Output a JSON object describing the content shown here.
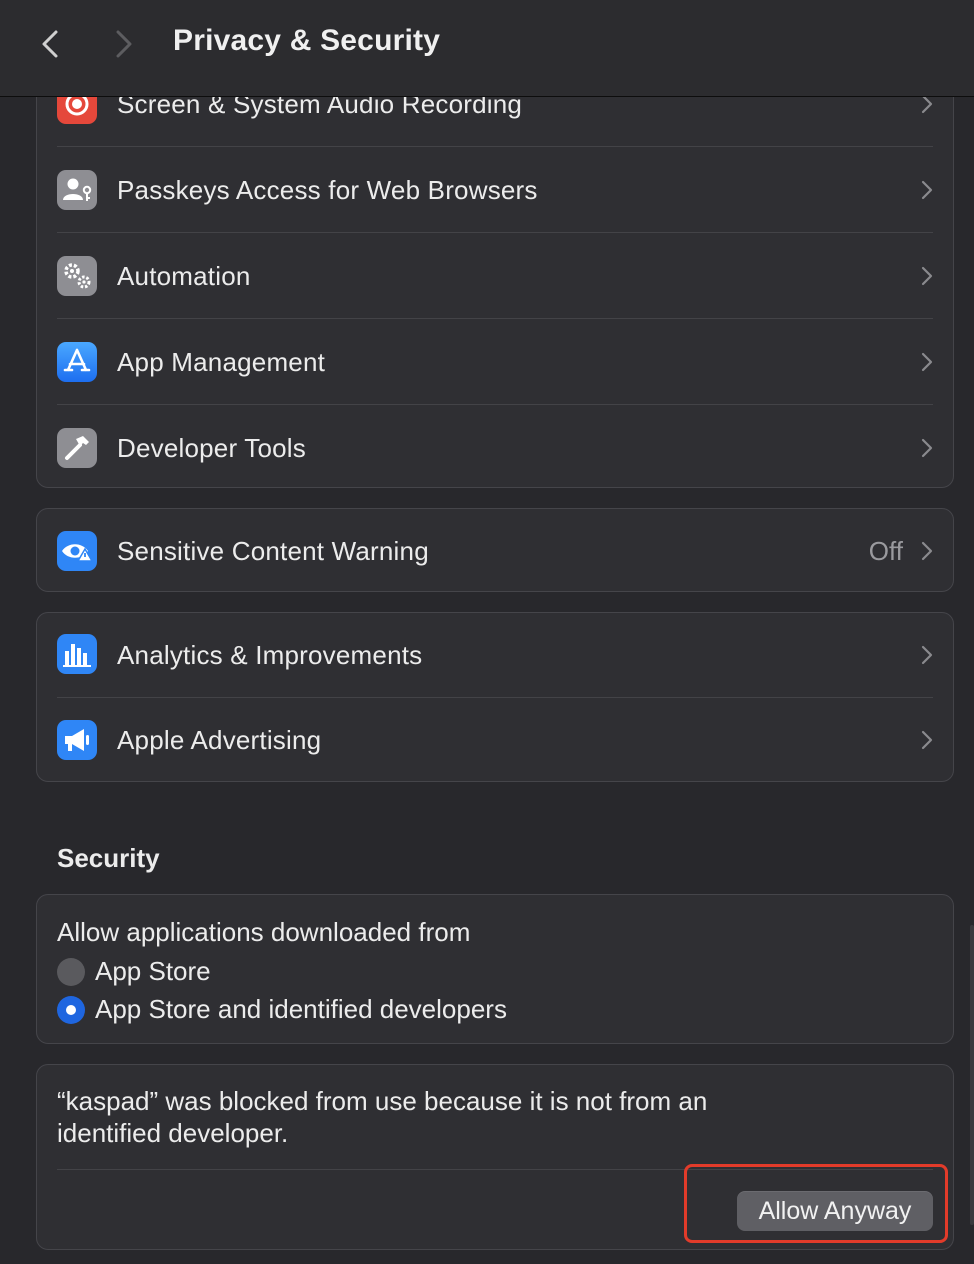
{
  "window": {
    "title": "Privacy & Security",
    "back_icon": "chevron-left-icon",
    "forward_icon": "chevron-right-icon"
  },
  "privacy_group_1": {
    "items": [
      {
        "label": "Screen & System Audio Recording",
        "icon": "screen-recording-icon",
        "icon_color": "#e5483b"
      },
      {
        "label": "Passkeys Access for Web Browsers",
        "icon": "passkey-person-icon",
        "icon_color": "#8e8e93"
      },
      {
        "label": "Automation",
        "icon": "gears-icon",
        "icon_color": "#8e8e93"
      },
      {
        "label": "App Management",
        "icon": "app-store-icon",
        "icon_color": "#2f86f6"
      },
      {
        "label": "Developer Tools",
        "icon": "hammer-icon",
        "icon_color": "#8e8e93"
      }
    ]
  },
  "privacy_group_2": {
    "items": [
      {
        "label": "Sensitive Content Warning",
        "value": "Off",
        "icon": "eye-warning-icon",
        "icon_color": "#2f86f6"
      }
    ]
  },
  "privacy_group_3": {
    "items": [
      {
        "label": "Analytics & Improvements",
        "icon": "bar-chart-icon",
        "icon_color": "#2f86f6"
      },
      {
        "label": "Apple Advertising",
        "icon": "megaphone-icon",
        "icon_color": "#2f86f6"
      }
    ]
  },
  "security": {
    "section_title": "Security",
    "allow_label": "Allow applications downloaded from",
    "options": [
      {
        "label": "App Store",
        "selected": false
      },
      {
        "label": "App Store and identified developers",
        "selected": true
      }
    ],
    "blocked_message": "“kaspad” was blocked from use because it is not from an identified developer.",
    "allow_button": "Allow Anyway"
  },
  "colors": {
    "background": "#28282c",
    "group_background": "#2f2f33",
    "accent": "#1f66e0",
    "highlight_box": "#e23b2a"
  }
}
